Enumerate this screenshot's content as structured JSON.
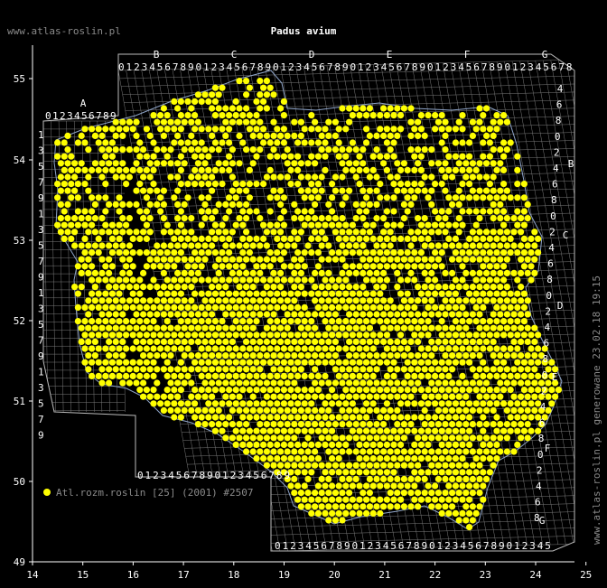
{
  "site": "www.atlas-roslin.pl",
  "title": "Padus avium",
  "generated": "www.atlas-roslin.pl generowane 23.02.18 19:15",
  "legend": {
    "label": "Atl.rozm.roslin [25] (2001) #2507",
    "color": "#ffff00"
  },
  "axes": {
    "x_ticks": [
      "14",
      "15",
      "16",
      "17",
      "18",
      "19",
      "20",
      "21",
      "22",
      "23",
      "24",
      "25"
    ],
    "y_ticks": [
      "55",
      "54",
      "53",
      "52",
      "51",
      "50",
      "49"
    ]
  },
  "grid": {
    "top_letters": [
      "B",
      "C",
      "D",
      "E",
      "F",
      "G"
    ],
    "top_digits": "01234567890123456789012345678901234567890123456789012345678",
    "left_letter": "A",
    "left_top_digits": "0123456789",
    "left_digits": [
      "1",
      "3",
      "5",
      "7",
      "9",
      "1",
      "3",
      "5",
      "7",
      "9",
      "1",
      "3",
      "5",
      "7",
      "9",
      "1",
      "3",
      "5",
      "7",
      "9"
    ],
    "right_letters": [
      "B",
      "C",
      "D",
      "E",
      "F",
      "G"
    ],
    "right_digits": [
      "4",
      "6",
      "8",
      "0",
      "2",
      "4",
      "6",
      "8",
      "0",
      "2",
      "4",
      "6",
      "8",
      "0",
      "2",
      "4",
      "6",
      "8",
      "0",
      "2",
      "4",
      "6",
      "8",
      "0",
      "2",
      "4",
      "6",
      "8"
    ],
    "bottom_left_digits": "01234567890123456789",
    "bottom_digits": "012345678901234567890123456789012345"
  },
  "colors": {
    "background": "#000000",
    "dots": "#ffff00",
    "grid": "#7a7a7a",
    "border": "#a9a9a9"
  }
}
